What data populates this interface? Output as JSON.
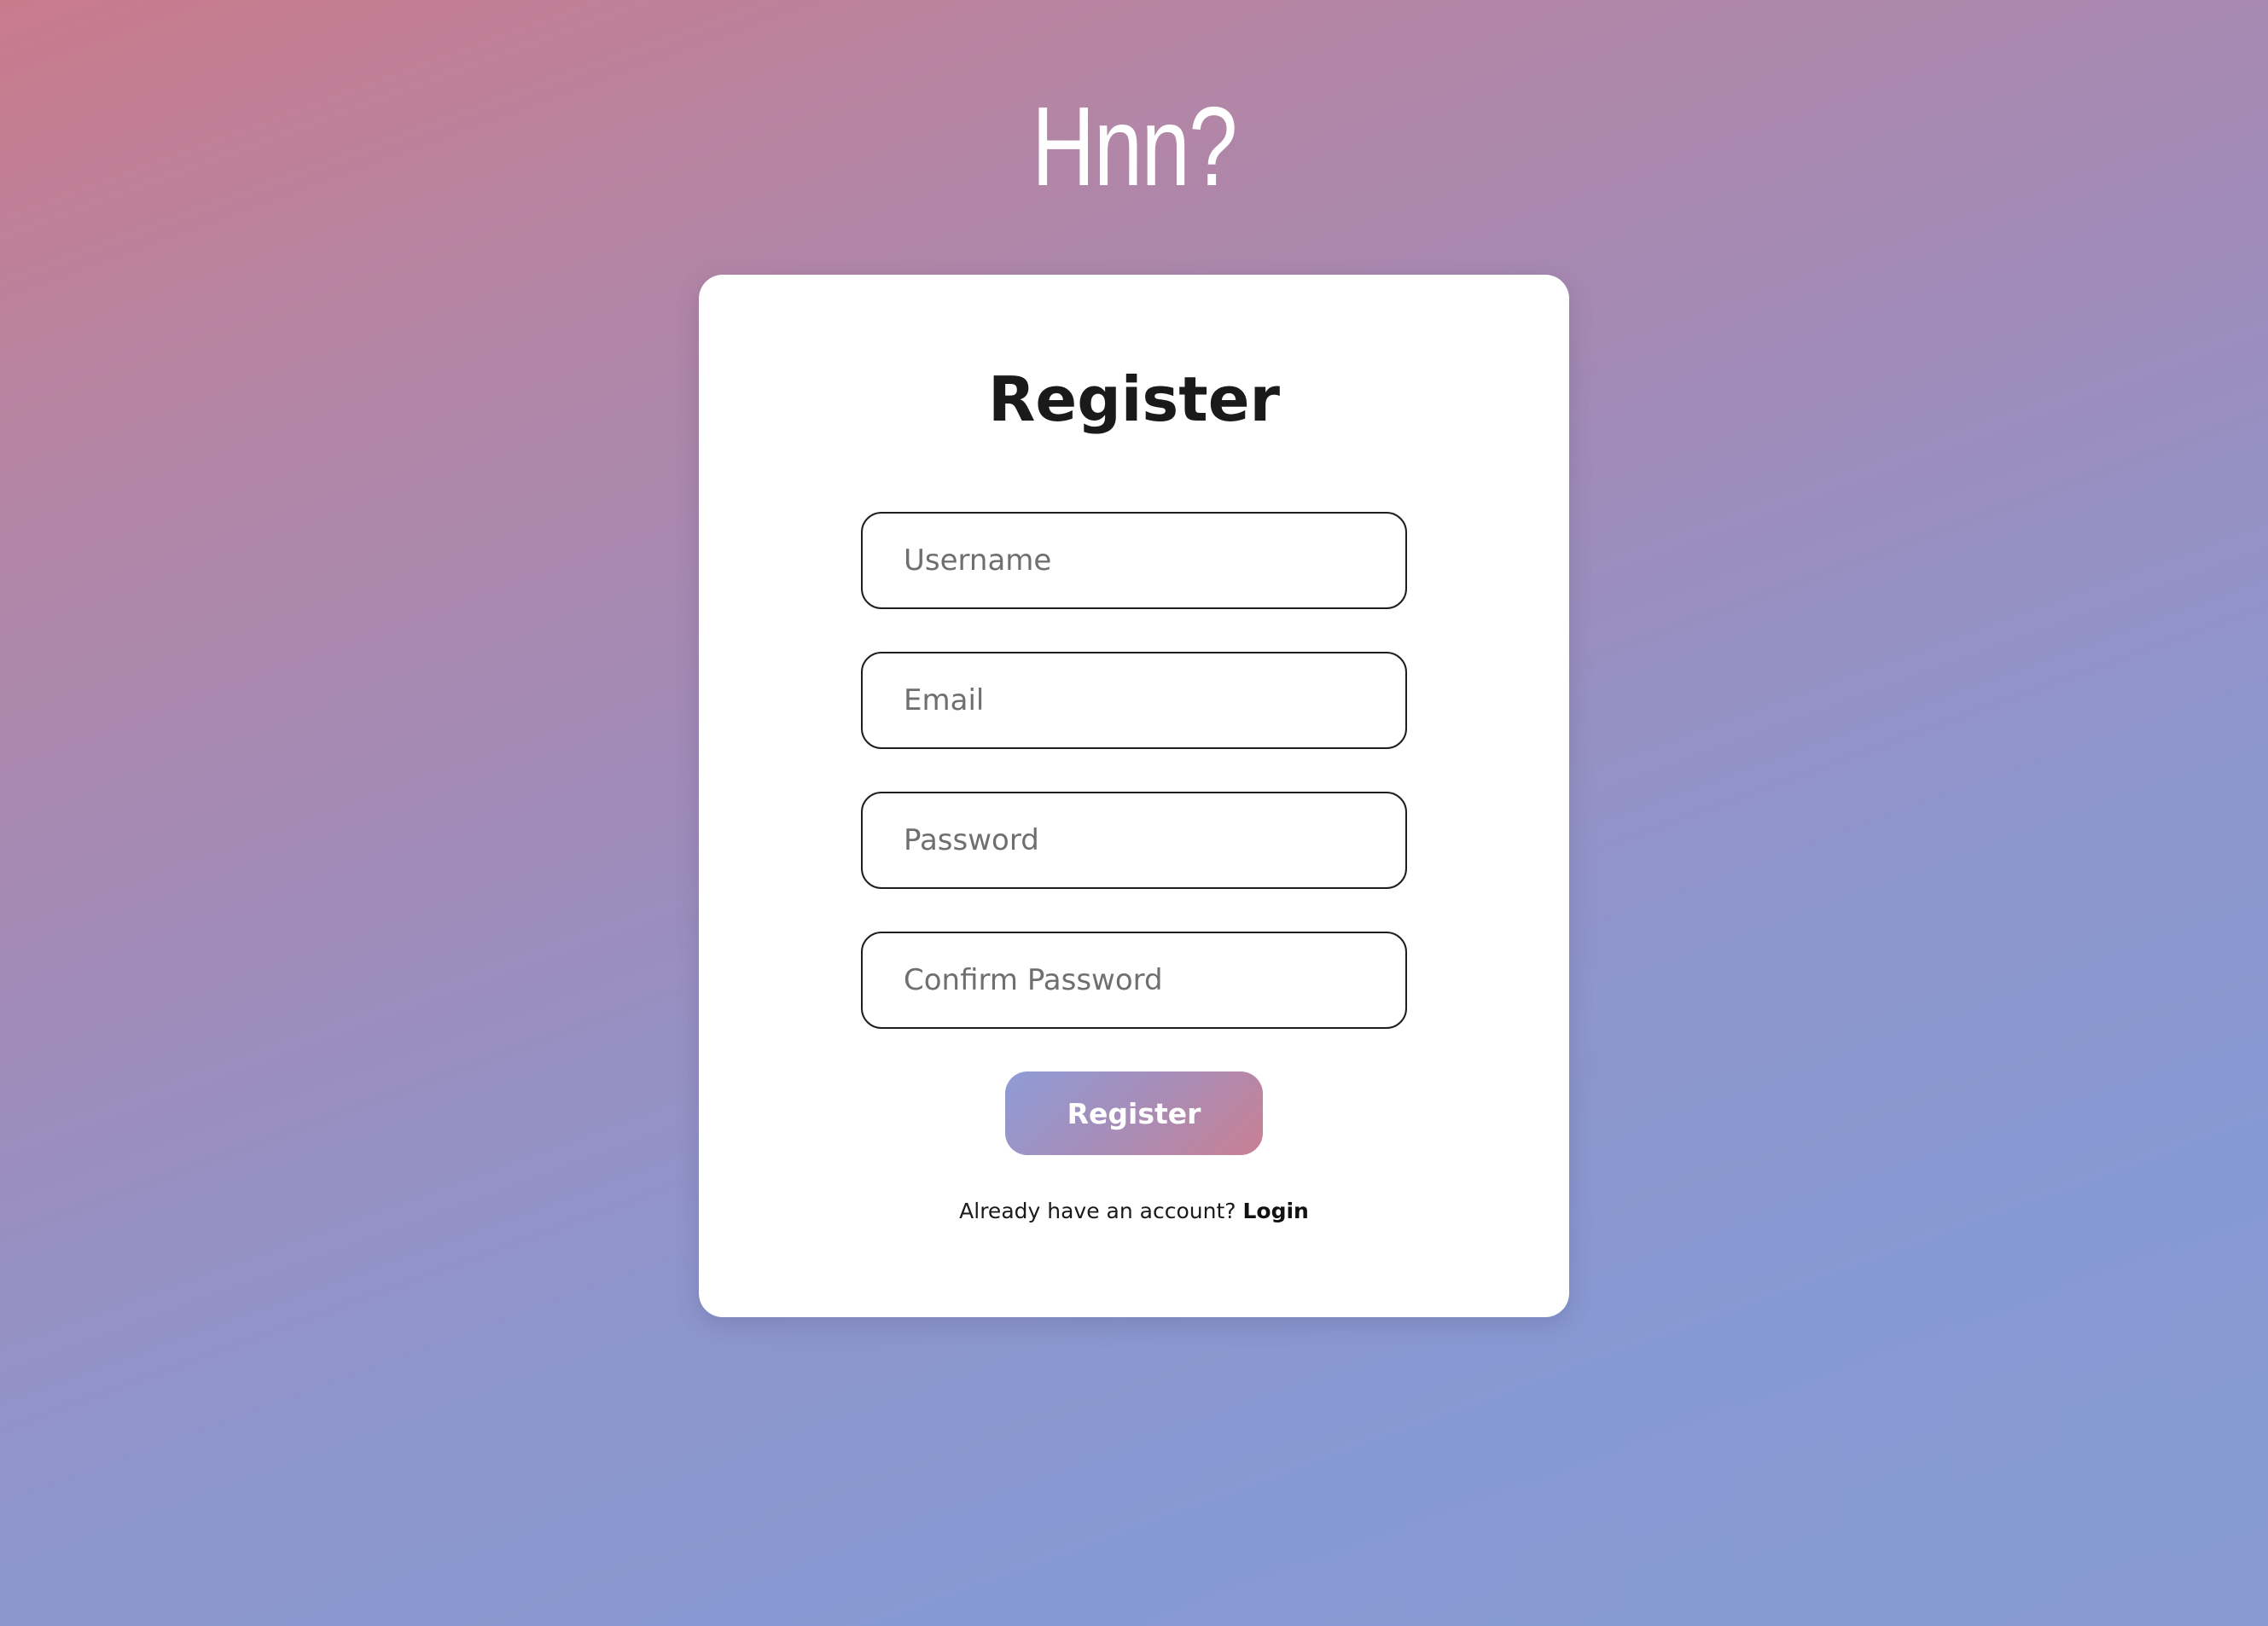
{
  "app": {
    "logo_text": "Hnn?"
  },
  "register_form": {
    "title": "Register",
    "fields": {
      "username": {
        "placeholder": "Username",
        "value": ""
      },
      "email": {
        "placeholder": "Email",
        "value": ""
      },
      "password": {
        "placeholder": "Password",
        "value": ""
      },
      "confirm_password": {
        "placeholder": "Confirm Password",
        "value": ""
      }
    },
    "submit_label": "Register",
    "footer": {
      "prompt": "Already have an account?",
      "link_label": "Login"
    }
  },
  "colors": {
    "background_top_left": "#c97b8c",
    "background_bottom_right": "#899ad2",
    "button_gradient_start": "#8f9bd6",
    "button_gradient_end": "#c98093",
    "card": "#ffffff",
    "text": "#1a1a1a"
  }
}
